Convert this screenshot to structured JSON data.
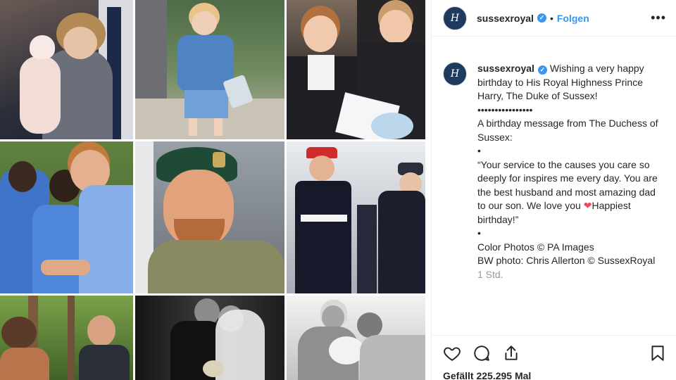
{
  "post": {
    "username": "sussexroyal",
    "verified_mark": "✓",
    "separator": "•",
    "follow_label": "Folgen",
    "more_icon": "more-dots",
    "avatar_monogram": "H",
    "caption": {
      "username": "sussexroyal",
      "line1": "Wishing a very happy birthday to His Royal Highness Prince Harry, The Duke of Sussex!",
      "dots": "••••••••••••••••",
      "line2": "A birthday message from The Duchess of Sussex:",
      "bullet1": "•",
      "quote": "“Your service to the causes you care so deeply for inspires me every day. You are the best husband and most amazing dad to our son. We love you",
      "heart": "❤",
      "quote_end": "Happiest birthday!”",
      "bullet2": "•",
      "credit1": "Color Photos © PA Images",
      "credit2": "BW photo: Chris Allerton © SussexRoyal"
    },
    "time": "1 Std.",
    "likes": "Gefällt 225.295 Mal"
  },
  "icons": [
    "heart-icon",
    "comment-icon",
    "share-icon",
    "bookmark-icon"
  ],
  "photos": [
    "photo-diana-baby",
    "photo-young-harry",
    "photo-princes-teen",
    "photo-harry-children",
    "photo-harry-beret",
    "photo-military-parade",
    "photo-jungle",
    "photo-wedding",
    "photo-baby-bw"
  ]
}
